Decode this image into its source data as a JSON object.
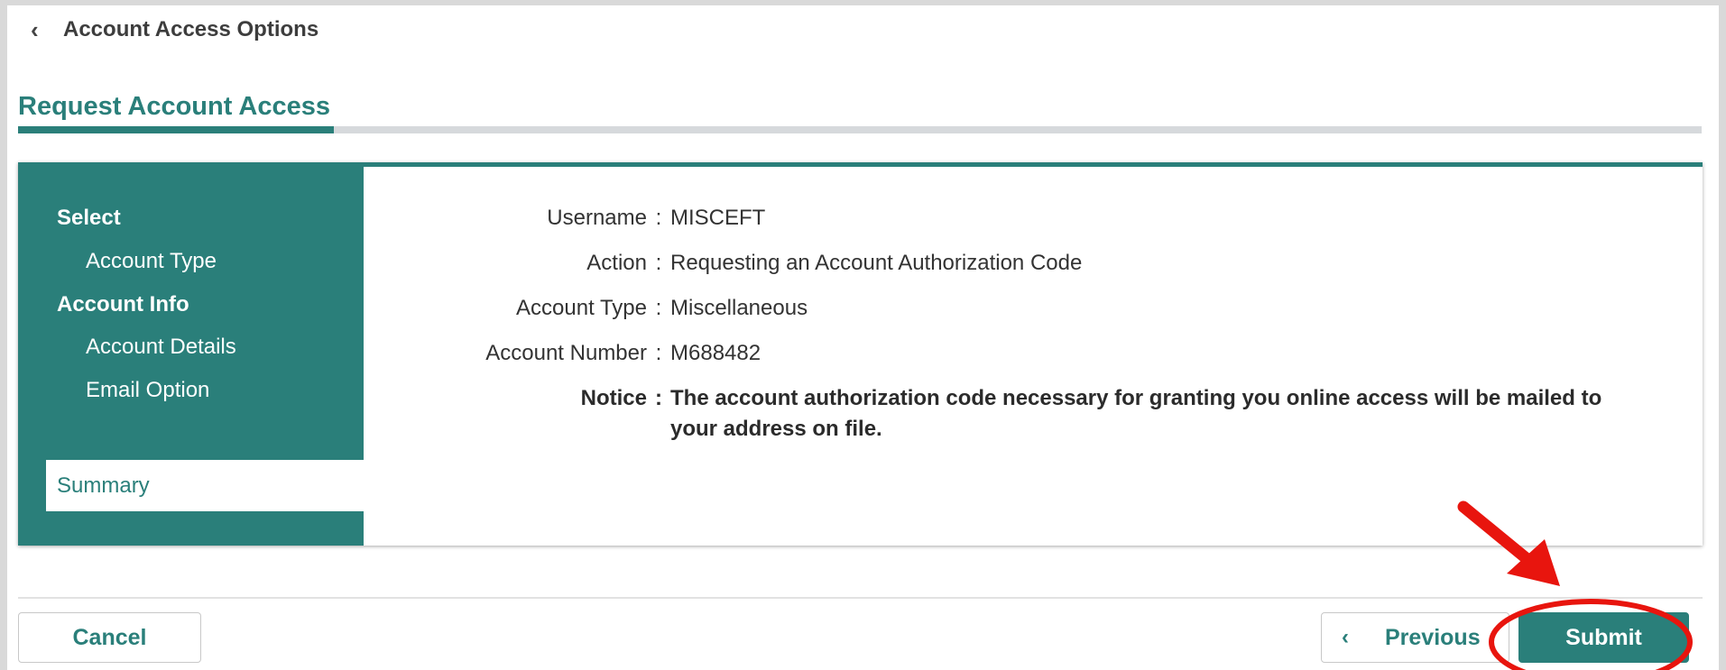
{
  "header": {
    "back_icon": "chevron-left-icon",
    "back_label": "Account Access Options",
    "page_title": "Request Account Access"
  },
  "stepper": {
    "groups": [
      {
        "label": "Select",
        "items": [
          "Account Type"
        ]
      },
      {
        "label": "Account Info",
        "items": [
          "Account Details",
          "Email Option"
        ]
      }
    ],
    "active_item": "Summary"
  },
  "summary": {
    "username_label": "Username",
    "username_value": "MISCEFT",
    "action_label": "Action",
    "action_value": "Requesting an Account Authorization Code",
    "account_type_label": "Account Type",
    "account_type_value": "Miscellaneous",
    "account_number_label": "Account Number",
    "account_number_value": "M688482",
    "notice_label": "Notice",
    "notice_value": "The account authorization code necessary for granting you online access will be mailed to your address on file.",
    "separator": ":"
  },
  "footer": {
    "cancel_label": "Cancel",
    "previous_label": "Previous",
    "previous_icon": "chevron-left-icon",
    "submit_label": "Submit"
  },
  "annotation": {
    "arrow_icon": "red-arrow-icon",
    "highlight_icon": "red-ellipse-highlight-icon",
    "color": "#e8150e"
  },
  "colors": {
    "accent": "#2a7f7a",
    "background": "#d9d9d9"
  }
}
